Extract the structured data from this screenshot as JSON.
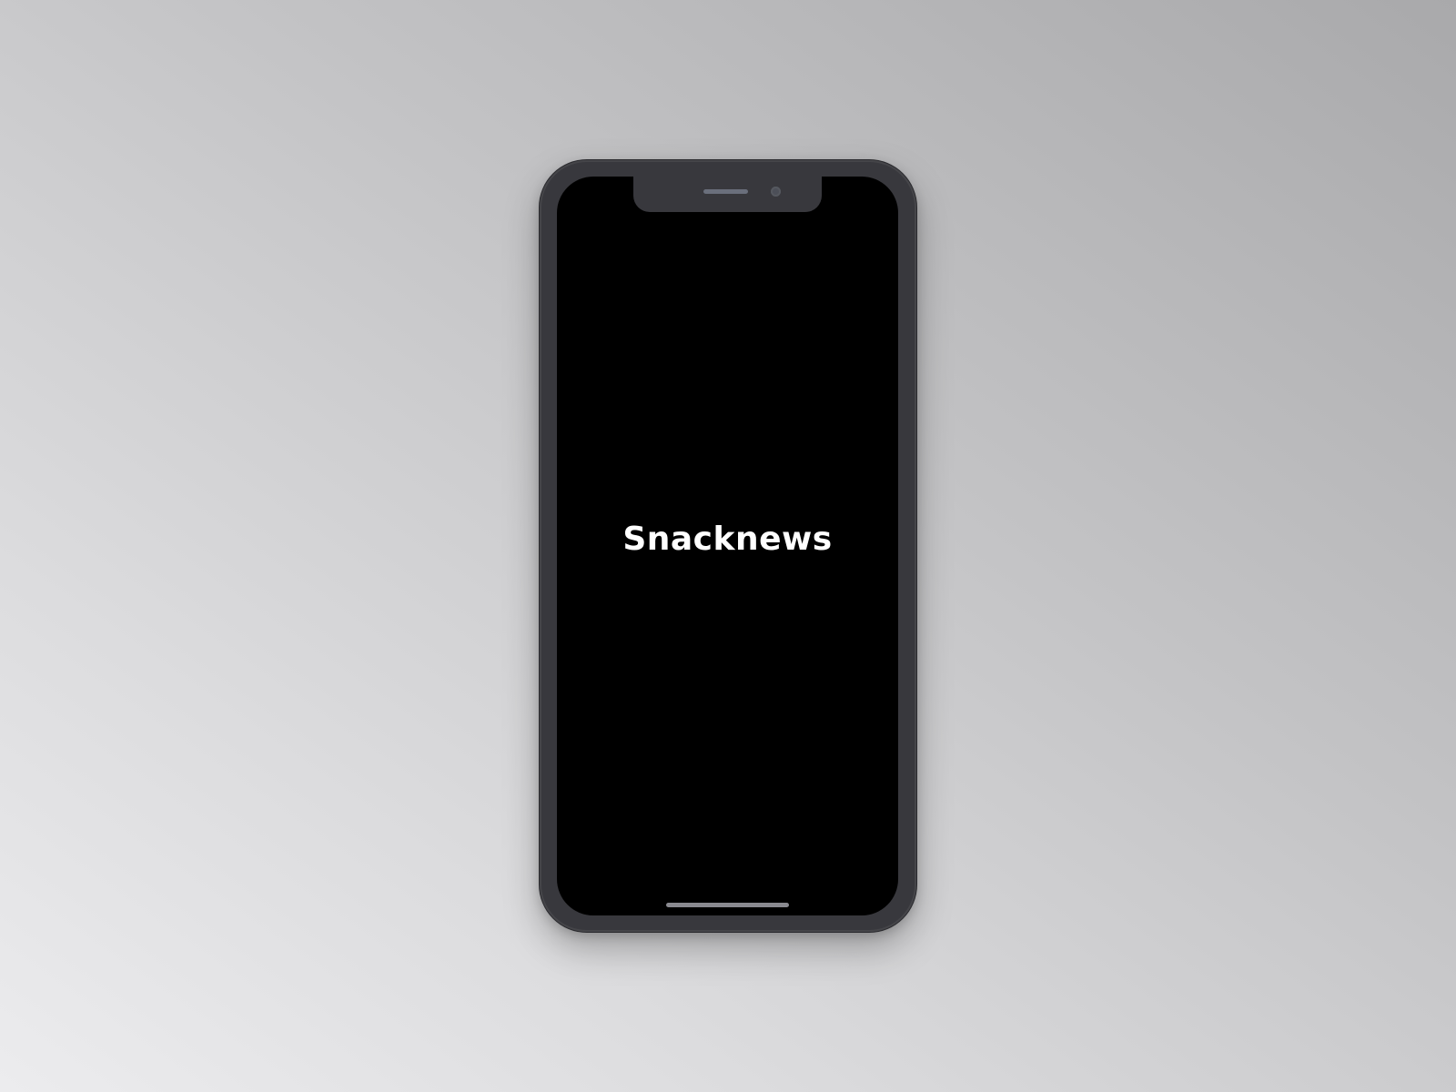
{
  "app": {
    "brand_name": "Snacknews"
  },
  "colors": {
    "screen_background": "#000000",
    "brand_text": "#ffffff",
    "device_frame": "#38383d"
  }
}
